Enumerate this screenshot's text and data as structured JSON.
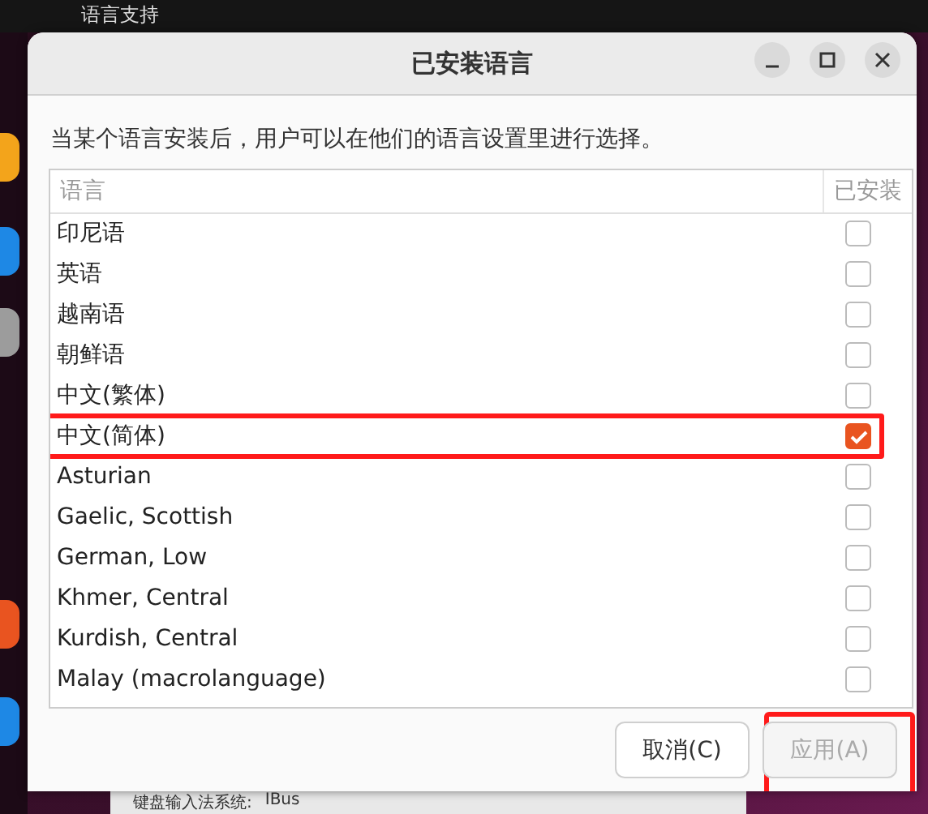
{
  "background_window": {
    "title": "语言支持",
    "input_method_label": "键盘输入法系统:",
    "input_method_value": "IBus"
  },
  "window": {
    "title": "已安装语言"
  },
  "description": "当某个语言安装后，用户可以在他们的语言设置里进行选择。",
  "table": {
    "columns": [
      "语言",
      "已安装"
    ]
  },
  "languages": [
    {
      "name": "印尼语",
      "installed": false,
      "highlighted": false
    },
    {
      "name": "英语",
      "installed": false,
      "highlighted": false
    },
    {
      "name": "越南语",
      "installed": false,
      "highlighted": false
    },
    {
      "name": "朝鲜语",
      "installed": false,
      "highlighted": false
    },
    {
      "name": "中文(繁体)",
      "installed": false,
      "highlighted": false
    },
    {
      "name": "中文(简体)",
      "installed": true,
      "highlighted": true
    },
    {
      "name": "Asturian",
      "installed": false,
      "highlighted": false
    },
    {
      "name": "Gaelic, Scottish",
      "installed": false,
      "highlighted": false
    },
    {
      "name": "German, Low",
      "installed": false,
      "highlighted": false
    },
    {
      "name": "Khmer, Central",
      "installed": false,
      "highlighted": false
    },
    {
      "name": "Kurdish, Central",
      "installed": false,
      "highlighted": false
    },
    {
      "name": "Malay (macrolanguage)",
      "installed": false,
      "highlighted": false
    }
  ],
  "buttons": [
    {
      "label": "取消(C)",
      "disabled": false,
      "highlighted": false
    },
    {
      "label": "应用(A)",
      "disabled": true,
      "highlighted": true
    }
  ]
}
